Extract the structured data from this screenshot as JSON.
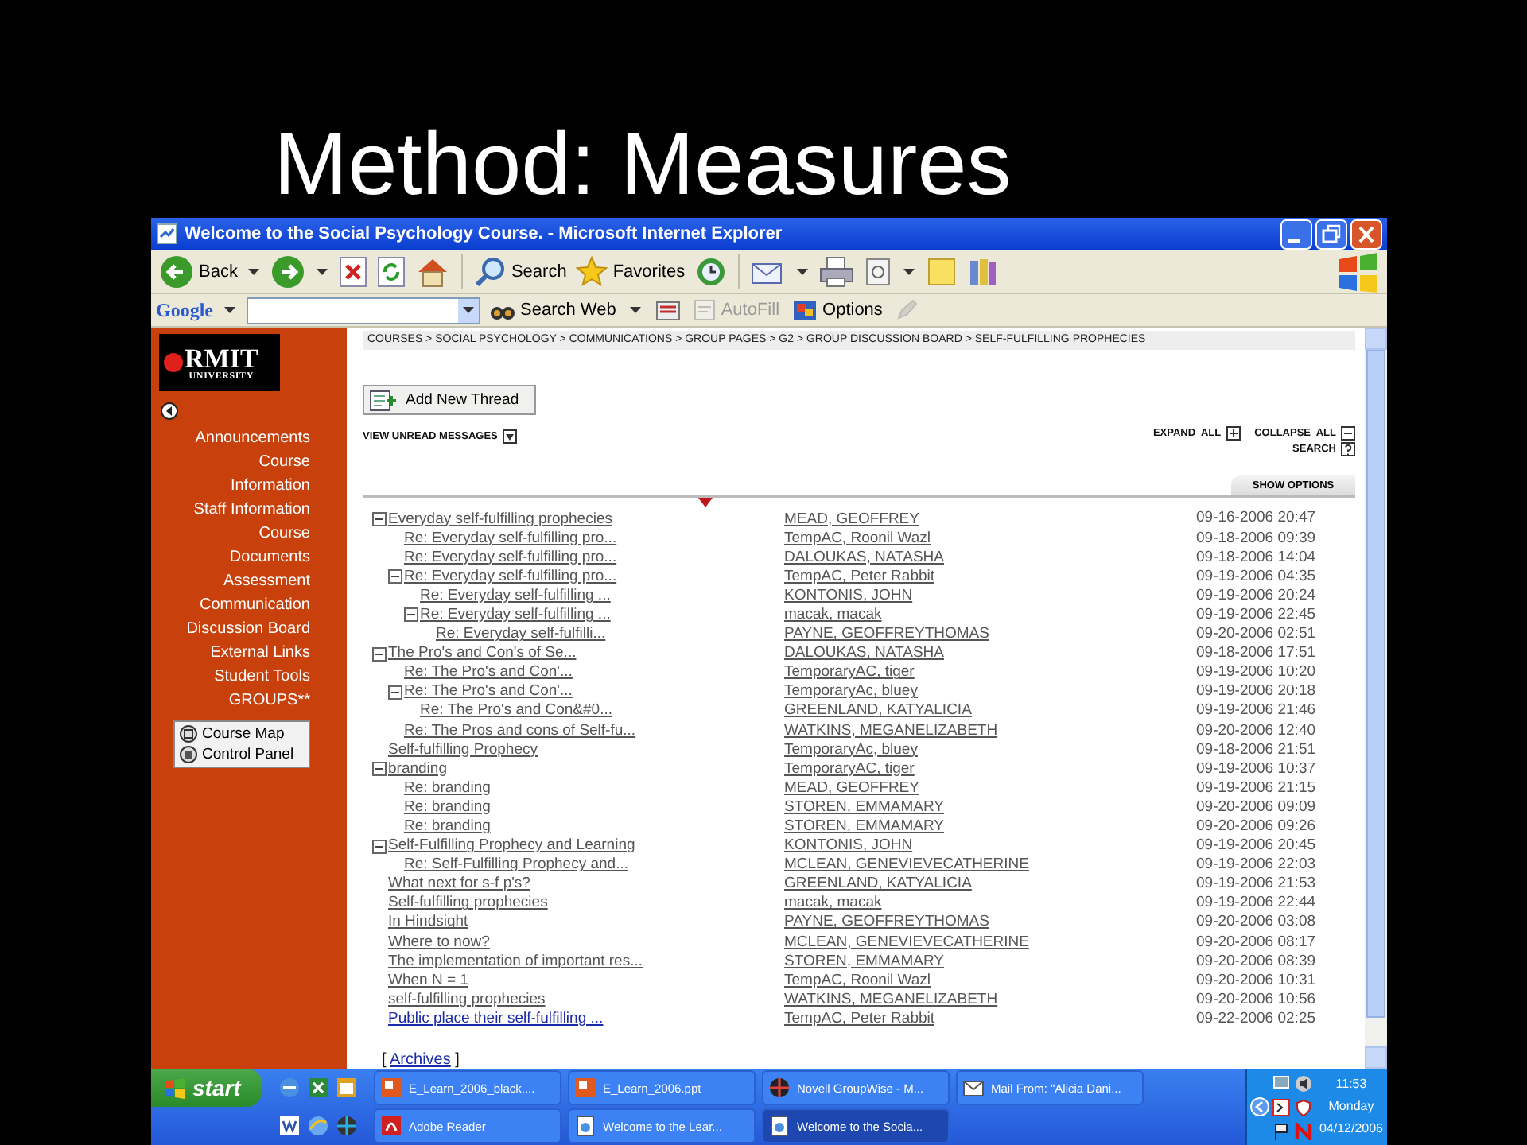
{
  "slide": {
    "title": "Method: Measures"
  },
  "window": {
    "title": "Welcome to the Social Psychology Course. - Microsoft Internet Explorer"
  },
  "toolbar": [
    {
      "kind": "back",
      "label": "Back",
      "menu": true
    },
    {
      "kind": "forward",
      "menu": true
    },
    {
      "kind": "stop",
      "menu": false
    },
    {
      "kind": "refresh",
      "menu": false
    },
    {
      "kind": "home",
      "menu": false
    },
    {
      "kind": "search",
      "label": "Search",
      "menu": false
    },
    {
      "kind": "favorites",
      "label": "Favorites",
      "menu": false
    },
    {
      "kind": "history",
      "menu": false
    },
    {
      "kind": "mail",
      "menu": true
    },
    {
      "kind": "print",
      "menu": false
    },
    {
      "kind": "edit",
      "menu": true
    },
    {
      "kind": "notes",
      "menu": false
    },
    {
      "kind": "research",
      "menu": false
    }
  ],
  "google_bar": {
    "logo": "Google",
    "items": [
      {
        "kind": "search",
        "label": "Search Web",
        "disabled": false
      },
      {
        "kind": "blocker",
        "disabled": false
      },
      {
        "kind": "autofill",
        "label": "AutoFill",
        "disabled": true
      },
      {
        "kind": "options",
        "label": "Options",
        "disabled": false
      },
      {
        "kind": "pen",
        "disabled": true
      }
    ]
  },
  "sidebar": {
    "logo": "RMIT",
    "logo_sub": "UNIVERSITY",
    "items": [
      "Announcements",
      "Course Information",
      "Staff Information",
      "Course Documents",
      "Assessment",
      "Communication",
      "Discussion Board",
      "External Links",
      "Student Tools",
      "GROUPS**"
    ],
    "tools": [
      {
        "kind": "map",
        "label": "Course Map"
      },
      {
        "kind": "panel",
        "label": "Control Panel"
      }
    ]
  },
  "breadcrumb": "COURSES > SOCIAL PSYCHOLOGY > COMMUNICATIONS > GROUP PAGES > G2 > GROUP DISCUSSION BOARD > SELF-FULFILLING PROPHECIES",
  "actions": {
    "add_thread": "Add New Thread",
    "view_unread": "VIEW UNREAD MESSAGES",
    "expand_all": "EXPAND  ALL",
    "collapse_all": "COLLAPSE  ALL",
    "search": "SEARCH",
    "show_options": "SHOW OPTIONS"
  },
  "threads": [
    {
      "title": "Everyday self-fulfilling prophecies",
      "author": "MEAD, GEOFFREY",
      "date": "09-16-2006 20:47",
      "unread": false,
      "expanded": true,
      "children": [
        {
          "title": "Re: Everyday self-fulfilling pro...",
          "author": "TempAC, Roonil Wazl",
          "date": "09-18-2006 09:39",
          "unread": false
        },
        {
          "title": "Re: Everyday self-fulfilling pro...",
          "author": "DALOUKAS, NATASHA",
          "date": "09-18-2006 14:04",
          "unread": false
        },
        {
          "title": "Re: Everyday self-fulfilling pro...",
          "author": "TempAC, Peter Rabbit",
          "date": "09-19-2006 04:35",
          "unread": false,
          "expanded": true,
          "children": [
            {
              "title": "Re: Everyday self-fulfilling ...",
              "author": "KONTONIS, JOHN",
              "date": "09-19-2006 20:24",
              "unread": false
            },
            {
              "title": "Re: Everyday self-fulfilling ...",
              "author": "macak, macak",
              "date": "09-19-2006 22:45",
              "unread": false,
              "expanded": true,
              "children": [
                {
                  "title": "Re: Everyday self-fulfilli...",
                  "author": "PAYNE, GEOFFREYTHOMAS",
                  "date": "09-20-2006 02:51",
                  "unread": false
                }
              ]
            }
          ]
        }
      ]
    },
    {
      "title": "The Pro's and Con's of Se...",
      "author": "DALOUKAS, NATASHA",
      "date": "09-18-2006 17:51",
      "unread": false,
      "expanded": true,
      "children": [
        {
          "title": "Re: The Pro's and Con'...",
          "author": "TemporaryAC, tiger",
          "date": "09-19-2006 10:20",
          "unread": false
        },
        {
          "title": "Re: The Pro's and Con'...",
          "author": "TemporaryAc, bluey",
          "date": "09-19-2006 20:18",
          "unread": false,
          "expanded": true,
          "children": [
            {
              "title": "Re: The Pro's and Con&#0...",
              "author": "GREENLAND, KATYALICIA",
              "date": "09-19-2006 21:46",
              "unread": false
            }
          ]
        },
        {
          "title": "Re: The Pros and cons of Self-fu...",
          "author": "WATKINS, MEGANELIZABETH",
          "date": "09-20-2006 12:40",
          "unread": false
        }
      ]
    },
    {
      "title": "Self-fulfilling Prophecy",
      "author": "TemporaryAc, bluey",
      "date": "09-18-2006 21:51",
      "unread": false
    },
    {
      "title": "branding",
      "author": "TemporaryAC, tiger",
      "date": "09-19-2006 10:37",
      "unread": false,
      "expanded": true,
      "children": [
        {
          "title": "Re: branding",
          "author": "MEAD, GEOFFREY",
          "date": "09-19-2006 21:15",
          "unread": false
        },
        {
          "title": "Re: branding",
          "author": "STOREN, EMMAMARY",
          "date": "09-20-2006 09:09",
          "unread": false
        },
        {
          "title": "Re: branding",
          "author": "STOREN, EMMAMARY",
          "date": "09-20-2006 09:26",
          "unread": false
        }
      ]
    },
    {
      "title": "Self-Fulfilling Prophecy and Learning",
      "author": "KONTONIS, JOHN",
      "date": "09-19-2006 20:45",
      "unread": false,
      "expanded": true,
      "children": [
        {
          "title": "Re: Self-Fulfilling Prophecy and...",
          "author": "MCLEAN, GENEVIEVECATHERINE",
          "date": "09-19-2006 22:03",
          "unread": false
        }
      ]
    },
    {
      "title": "What next for s-f p's?",
      "author": "GREENLAND, KATYALICIA",
      "date": "09-19-2006 21:53",
      "unread": false
    },
    {
      "title": "Self-fulfilling prophecies",
      "author": "macak, macak",
      "date": "09-19-2006 22:44",
      "unread": false
    },
    {
      "title": "In Hindsight",
      "author": "PAYNE, GEOFFREYTHOMAS",
      "date": "09-20-2006 03:08",
      "unread": false
    },
    {
      "title": "Where to now?",
      "author": "MCLEAN, GENEVIEVECATHERINE",
      "date": "09-20-2006 08:17",
      "unread": false
    },
    {
      "title": "The implementation of important res...",
      "author": "STOREN, EMMAMARY",
      "date": "09-20-2006 08:39",
      "unread": false
    },
    {
      "title": "When N = 1",
      "author": "TempAC, Roonil Wazl",
      "date": "09-20-2006 10:31",
      "unread": false
    },
    {
      "title": "self-fulfilling prophecies",
      "author": "WATKINS, MEGANELIZABETH",
      "date": "09-20-2006 10:56",
      "unread": false
    },
    {
      "title": "Public place their self-fulfilling ...",
      "author": "TempAC, Peter Rabbit",
      "date": "09-22-2006 02:25",
      "unread": true
    }
  ],
  "archives": {
    "before": "[",
    "link": "Archives",
    "after": "]"
  },
  "taskbar": {
    "start": "start",
    "quick_launch": [
      {
        "kind": "ie"
      },
      {
        "kind": "excel"
      },
      {
        "kind": "outlook"
      },
      {
        "kind": "word"
      },
      {
        "kind": "ie2"
      },
      {
        "kind": "globe"
      }
    ],
    "tasks": [
      {
        "kind": "ppt",
        "label": "E_Learn_2006_black....",
        "selected": false
      },
      {
        "kind": "ppt",
        "label": "E_Learn_2006.ppt",
        "selected": false
      },
      {
        "kind": "groupwise",
        "label": "Novell GroupWise - M...",
        "selected": false
      },
      {
        "kind": "mail",
        "label": "Mail From: \"Alicia Dani...",
        "selected": false
      },
      {
        "kind": "pdf",
        "label": "Adobe Reader",
        "selected": false
      },
      {
        "kind": "page",
        "label": "Welcome to the Lear...",
        "selected": false
      },
      {
        "kind": "page",
        "label": "Welcome to the Socia...",
        "selected": true
      }
    ],
    "clock": {
      "time": "11:53",
      "day": "Monday",
      "date": "04/12/2006"
    }
  }
}
